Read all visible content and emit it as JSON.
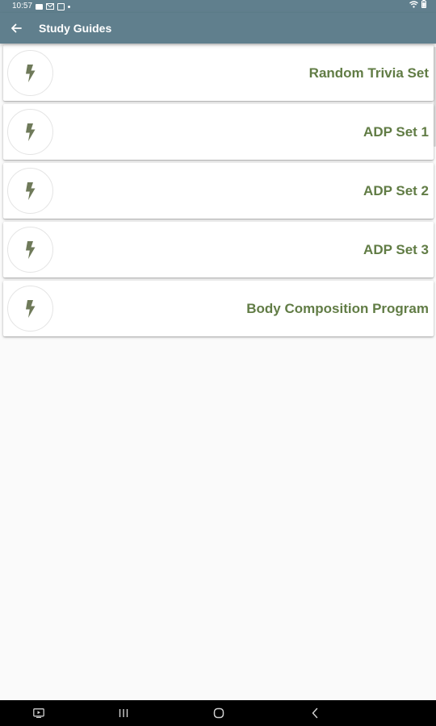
{
  "status_bar": {
    "time": "10:57",
    "left_icons": [
      "photo-notification-icon",
      "mail-notification-icon",
      "app-notification-icon",
      "dot-icon"
    ],
    "right_icons": [
      "wifi-icon",
      "battery-icon"
    ]
  },
  "app_bar": {
    "title": "Study Guides",
    "back_icon": "arrow-left-icon",
    "background_color": "#607f8d"
  },
  "list": {
    "accent_color": "#617c45",
    "item_icon": "lightning-bolt-icon",
    "items": [
      {
        "label": "Random Trivia Set"
      },
      {
        "label": "ADP Set 1"
      },
      {
        "label": "ADP Set 2"
      },
      {
        "label": "ADP Set 3"
      },
      {
        "label": "Body Composition Program"
      }
    ]
  },
  "nav_bar": {
    "buttons": [
      "recent-apps-icon",
      "home-icon",
      "back-icon"
    ],
    "extra_left": "screenshot-icon"
  }
}
